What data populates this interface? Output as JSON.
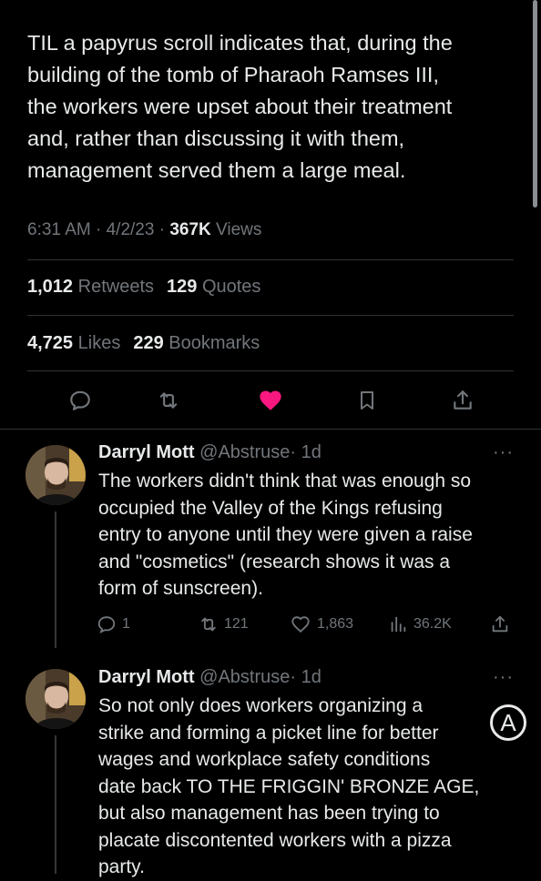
{
  "tweet": {
    "text": "TIL a papyrus scroll indicates that, during the\nbuilding of the tomb of Pharaoh Ramses III,\nthe workers were upset about their treatment\nand,  rather than discussing it with them,\nmanagement served them a large meal.",
    "time": "6:31 AM",
    "sep1": " · ",
    "date": "4/2/23",
    "sep2": " · ",
    "views_count": "367K",
    "views_label": "Views",
    "retweets_count": "1,012",
    "retweets_label": "Retweets",
    "quotes_count": "129",
    "quotes_label": "Quotes",
    "likes_count": "4,725",
    "likes_label": "Likes",
    "bookmarks_count": "229",
    "bookmarks_label": "Bookmarks"
  },
  "icons": {
    "reply": "reply-icon",
    "retweet": "retweet-icon",
    "like": "heart-icon",
    "bookmark": "bookmark-icon",
    "share": "share-icon",
    "views": "bar-chart-icon",
    "more": "more-icon"
  },
  "colors": {
    "like": "#f91880",
    "muted": "#71767b",
    "text": "#e7e9ea",
    "background": "#000000"
  },
  "replies": [
    {
      "name": "Darryl Mott",
      "handle": "@Abstruse",
      "time": "· 1d",
      "more": "···",
      "text": "The workers didn't think that was enough so\noccupied the Valley of the  Kings refusing\nentry to anyone until they were given a raise\nand  \"cosmetics\" (research shows it was a\nform of sunscreen).",
      "reply_count": "1",
      "retweet_count": "121",
      "like_count": "1,863",
      "view_count": "36.2K"
    },
    {
      "name": "Darryl Mott",
      "handle": "@Abstruse",
      "time": "· 1d",
      "more": "···",
      "text": "So not only does workers organizing a\nstrike and forming a picket line for better\nwages and workplace safety conditions\ndate back TO THE FRIGGIN' BRONZE  AGE,\nbut also management has been trying to\nplacate discontented workers with a pizza\nparty."
    }
  ],
  "badge": "A"
}
